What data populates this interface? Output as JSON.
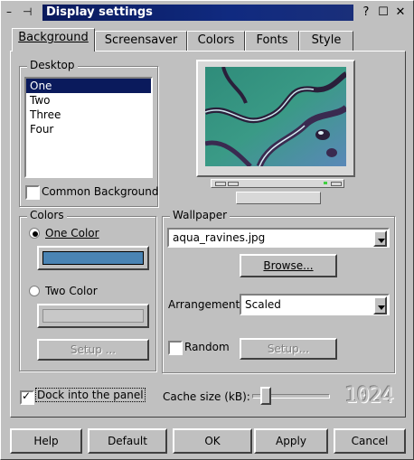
{
  "window": {
    "title": "Display settings",
    "titlebar_icons": [
      "minimize-dash-icon",
      "pin-icon"
    ],
    "titlebar_buttons": [
      "help-icon",
      "restore-icon",
      "close-icon"
    ]
  },
  "tabs": [
    {
      "label": "Background",
      "active": true
    },
    {
      "label": "Screensaver",
      "active": false
    },
    {
      "label": "Colors",
      "active": false
    },
    {
      "label": "Fonts",
      "active": false
    },
    {
      "label": "Style",
      "active": false
    }
  ],
  "desktop": {
    "group_title": "Desktop",
    "items": [
      "One",
      "Two",
      "Three",
      "Four"
    ],
    "selected": "One",
    "common_background_label": "Common Background",
    "common_background_checked": false
  },
  "preview": {
    "image_name": "aqua_ravines.jpg"
  },
  "colors": {
    "group_title": "Colors",
    "one_color_label": "One Color",
    "one_color_selected": true,
    "one_color_value": "#4a84b4",
    "two_color_label": "Two Color",
    "two_color_selected": false,
    "setup_label": "Setup ..."
  },
  "wallpaper": {
    "group_title": "Wallpaper",
    "file": "aqua_ravines.jpg",
    "browse_label": "Browse...",
    "arrangement_label": "Arrangement:",
    "arrangement_value": "Scaled",
    "random_label": "Random",
    "random_checked": false,
    "setup_label": "Setup..."
  },
  "dock": {
    "label": "Dock into the panel",
    "checked": true
  },
  "cache": {
    "label": "Cache size (kB):",
    "value": "1024",
    "slider_fraction": 0.12
  },
  "buttons": {
    "help": "Help",
    "default": "Default",
    "ok": "OK",
    "apply": "Apply",
    "cancel": "Cancel"
  }
}
